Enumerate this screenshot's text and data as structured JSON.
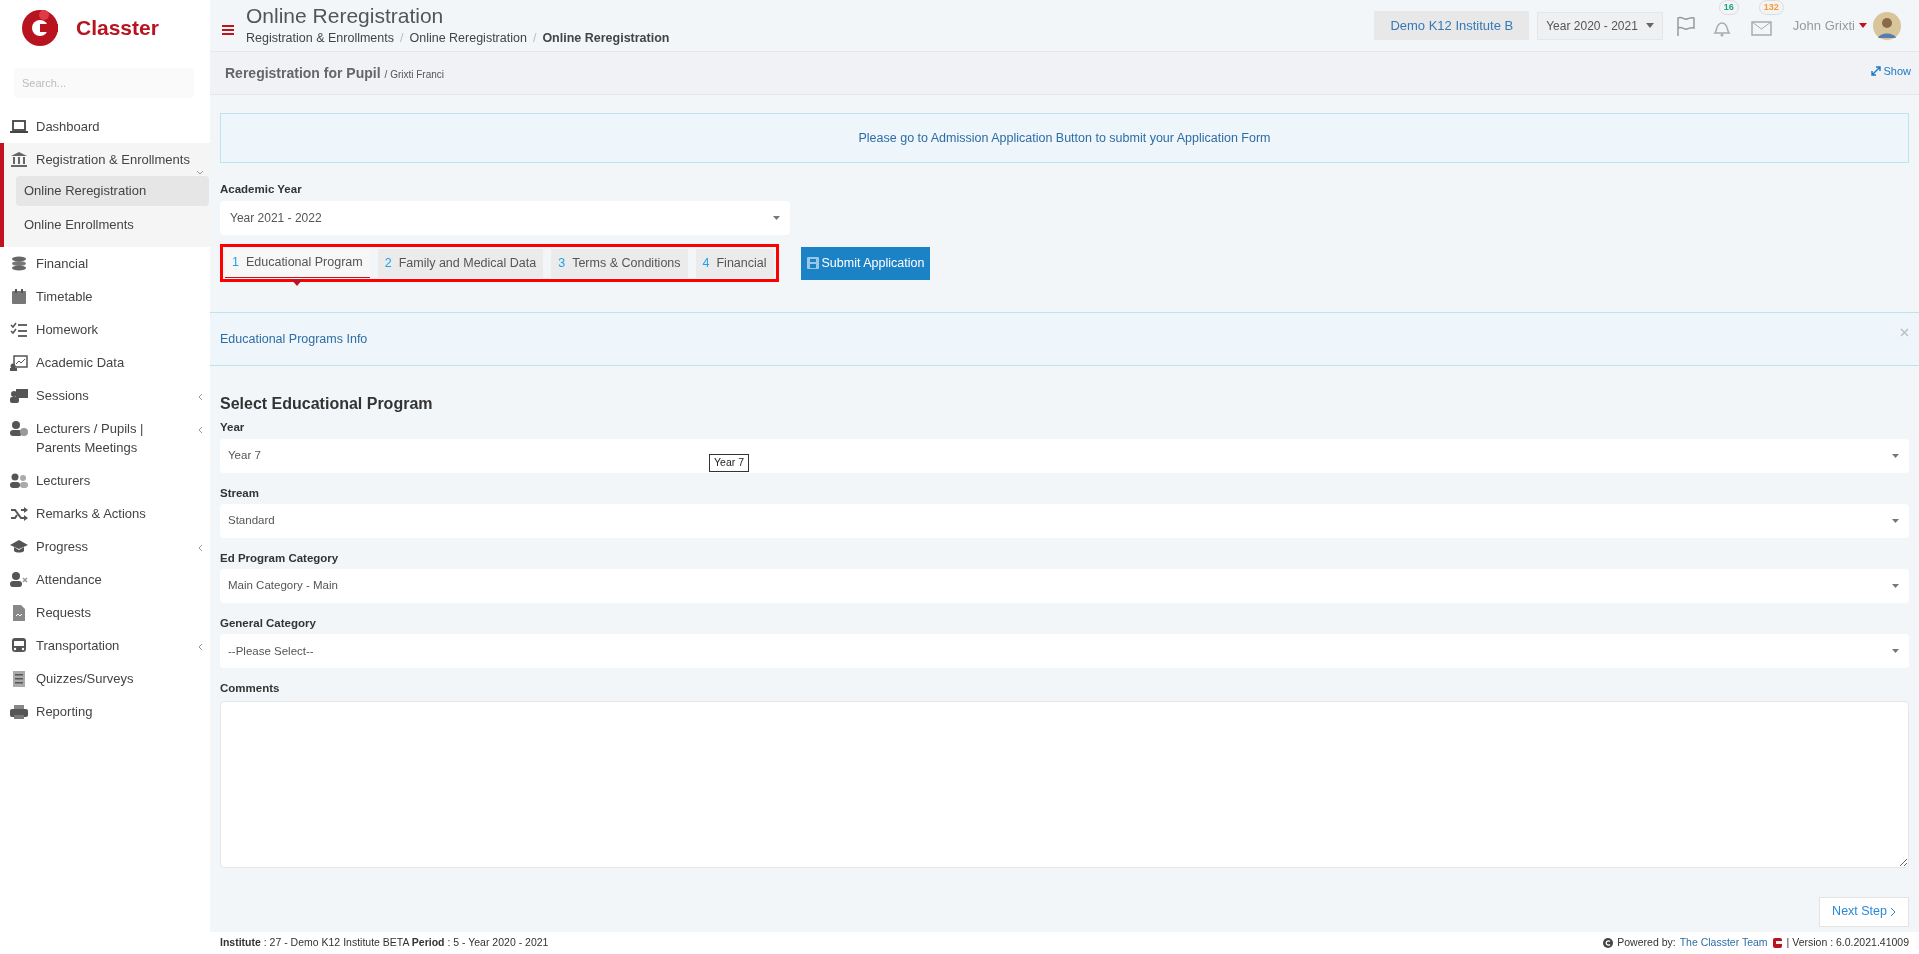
{
  "brand": {
    "name": "Classter"
  },
  "sidebar": {
    "search_placeholder": "Search...",
    "items": [
      {
        "label": "Dashboard",
        "kind": "link",
        "selected": false
      },
      {
        "label": "Registration & Enrollments",
        "kind": "group",
        "expanded": true,
        "selected": true,
        "children": [
          {
            "label": "Online Reregistration",
            "selected": true
          },
          {
            "label": "Online Enrollments",
            "selected": false
          }
        ]
      },
      {
        "label": "Financial",
        "kind": "link",
        "selected": false
      },
      {
        "label": "Timetable",
        "kind": "link",
        "selected": false
      },
      {
        "label": "Homework",
        "kind": "link",
        "selected": false
      },
      {
        "label": "Academic Data",
        "kind": "link",
        "selected": false
      },
      {
        "label": "Sessions",
        "kind": "group",
        "expanded": false,
        "selected": false
      },
      {
        "label": "Lecturers / Pupils | Parents Meetings",
        "kind": "group",
        "expanded": false,
        "selected": false
      },
      {
        "label": "Lecturers",
        "kind": "link",
        "selected": false
      },
      {
        "label": "Remarks & Actions",
        "kind": "link",
        "selected": false
      },
      {
        "label": "Progress",
        "kind": "group",
        "expanded": false,
        "selected": false
      },
      {
        "label": "Attendance",
        "kind": "link",
        "selected": false
      },
      {
        "label": "Requests",
        "kind": "link",
        "selected": false
      },
      {
        "label": "Transportation",
        "kind": "group",
        "expanded": false,
        "selected": false
      },
      {
        "label": "Quizzes/Surveys",
        "kind": "link",
        "selected": false
      },
      {
        "label": "Reporting",
        "kind": "link",
        "selected": false
      }
    ]
  },
  "header": {
    "title": "Online Reregistration",
    "breadcrumbs": [
      "Registration & Enrollments",
      "Online Reregistration",
      "Online Reregistration"
    ],
    "breadcrumb_separator": "/",
    "institute": "Demo K12 Institute B",
    "year": "Year 2020 - 2021",
    "notifications": "16",
    "messages": "132",
    "user": "John Grixti"
  },
  "page_title": {
    "title": "Reregistration for Pupil",
    "subtitle": "/ Grixti Franci",
    "show": "Show"
  },
  "notice": "Please go to Admission Application Button to submit your Application Form",
  "academic_year": {
    "label": "Academic Year",
    "value": "Year 2021 - 2022"
  },
  "tabs": [
    {
      "number": "1",
      "label": "Educational Program",
      "selected": true
    },
    {
      "number": "2",
      "label": "Family and Medical Data",
      "selected": false
    },
    {
      "number": "3",
      "label": "Terms & Conditions",
      "selected": false
    },
    {
      "number": "4",
      "label": "Financial",
      "selected": false
    }
  ],
  "submit_button": "Submit Application",
  "info_panel": "Educational Programs Info",
  "section_title": "Select Educational Program",
  "fields": [
    {
      "label": "Year",
      "kind": "select",
      "value": "Year 7"
    },
    {
      "label": "Stream",
      "kind": "select",
      "value": "Standard"
    },
    {
      "label": "Ed Program Category",
      "kind": "select",
      "value": "Main Category - Main"
    },
    {
      "label": "General Category",
      "kind": "select",
      "value": "--Please Select--"
    },
    {
      "label": "Comments",
      "kind": "textarea"
    }
  ],
  "tooltip": "Year 7",
  "next_button": "Next Step",
  "status_bar": {
    "left": "**Institute** : 27 - Demo K12 Institute BETA **Period** : 5 - Year 2020 - 2021",
    "powered": "Powered by:",
    "team": "The Classter Team",
    "version": "| Version : 6.0.2021.41009"
  }
}
